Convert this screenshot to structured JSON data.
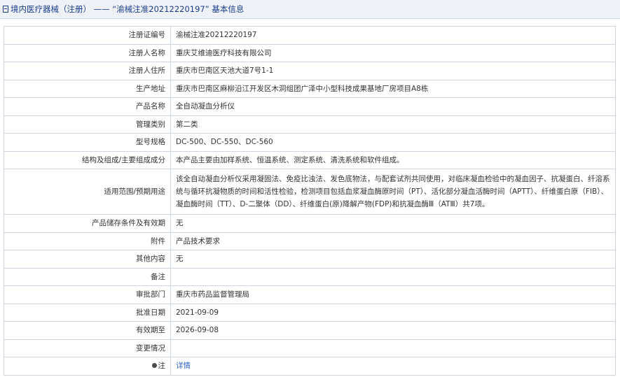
{
  "header": {
    "title": "境内医疗器械（注册） —— “渝械注准20212220197” 基本信息"
  },
  "rows": {
    "reg_no": {
      "label": "注册证编号",
      "value": "渝械注准20212220197"
    },
    "registrant_name": {
      "label": "注册人名称",
      "value": "重庆艾维迪医疗科技有限公司"
    },
    "registrant_address": {
      "label": "注册人住所",
      "value": "重庆市巴南区天池大道7号1-1"
    },
    "production_address": {
      "label": "生产地址",
      "value": "重庆市巴南区麻柳沿江开发区木洞组团广泽中小型科技成果基地厂房项目A8栋"
    },
    "product_name": {
      "label": "产品名称",
      "value": "全自动凝血分析仪"
    },
    "category": {
      "label": "管理类别",
      "value": "第二类"
    },
    "model": {
      "label": "型号规格",
      "value": "DC-500、DC-550、DC-560"
    },
    "structure": {
      "label": "结构及组成/主要组成成分",
      "value": "本产品主要由加样系统、恒温系统、测定系统、清洗系统和软件组成。"
    },
    "scope": {
      "label": "适用范围/预期用途",
      "value": "该全自动凝血分析仪采用凝固法、免疫比浊法、发色底物法，与配套试剂共同使用，对临床凝血检验中的凝血因子、抗凝蛋白、纤溶系统与循环抗凝物质的时间和活性检验，检测项目包括血浆凝血酶原时间（PT）、活化部分凝血活酶时间（APTT）、纤维蛋白原（FIB）、凝血酶时间（TT）、D-二聚体（DD）、纤维蛋白(原)降解产物(FDP)和抗凝血酶Ⅲ（ATⅢ）共7项。"
    },
    "storage": {
      "label": "产品储存条件及有效期",
      "value": "无"
    },
    "accessory": {
      "label": "附件",
      "value": "产品技术要求"
    },
    "other": {
      "label": "其他内容",
      "value": "无"
    },
    "remark": {
      "label": "备注",
      "value": ""
    },
    "approval_dept": {
      "label": "审批部门",
      "value": "重庆市药品监督管理局"
    },
    "approval_date": {
      "label": "批准日期",
      "value": "2021-09-09"
    },
    "valid_until": {
      "label": "有效期至",
      "value": "2026-09-08"
    },
    "changes": {
      "label": "变更情况",
      "value": ""
    },
    "note": {
      "label": "注",
      "value": "详情"
    }
  }
}
